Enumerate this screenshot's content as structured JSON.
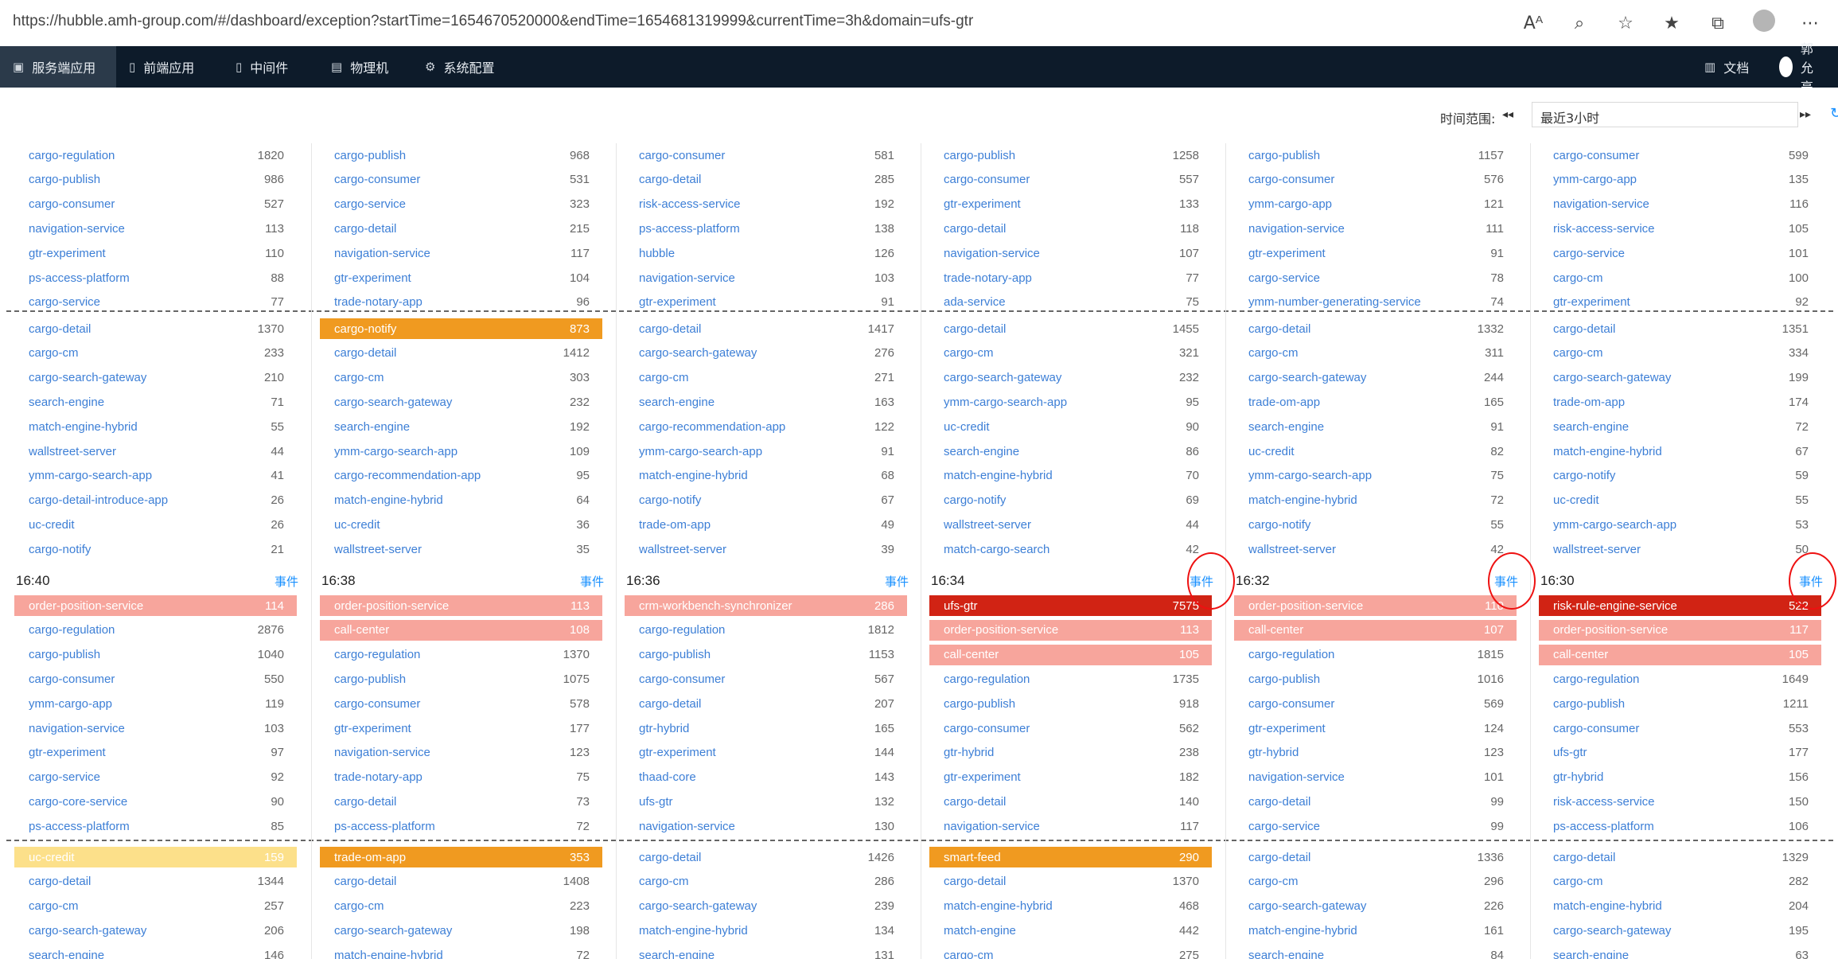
{
  "browser": {
    "url": "https://hubble.amh-group.com/#/dashboard/exception?startTime=1654670520000&endTime=1654681319999&currentTime=3h&domain=ufs-gtr",
    "tool_icons": [
      "Aᴬ",
      "⌕",
      "☆",
      "★",
      "⧉",
      "●",
      "⋯"
    ]
  },
  "nav": {
    "items": [
      {
        "label": "服务端应用",
        "icon": "▣"
      },
      {
        "label": "前端应用",
        "icon": "▯"
      },
      {
        "label": "中间件",
        "icon": "▯"
      },
      {
        "label": "物理机",
        "icon": "▤"
      },
      {
        "label": "系统配置",
        "icon": "⚙"
      }
    ],
    "docs_label": "文档",
    "docs_icon": "▥",
    "user_name": "郭允亮"
  },
  "toolbar": {
    "time_range_label": "时间范围:",
    "prev_icon": "◂◂",
    "time_range_value": "最近3小时",
    "next_icon": "▸▸",
    "refresh_icon": "↻"
  },
  "event_label": "事件",
  "columns": [
    {
      "top1": [
        [
          "cargo-regulation",
          "1820"
        ],
        [
          "cargo-publish",
          "986"
        ],
        [
          "cargo-consumer",
          "527"
        ],
        [
          "navigation-service",
          "113"
        ],
        [
          "gtr-experiment",
          "110"
        ],
        [
          "ps-access-platform",
          "88"
        ],
        [
          "cargo-service",
          "77"
        ]
      ],
      "top2": [
        [
          "cargo-detail",
          "1370"
        ],
        [
          "cargo-cm",
          "233"
        ],
        [
          "cargo-search-gateway",
          "210"
        ],
        [
          "search-engine",
          "71"
        ],
        [
          "match-engine-hybrid",
          "55"
        ],
        [
          "wallstreet-server",
          "44"
        ],
        [
          "ymm-cargo-search-app",
          "41"
        ],
        [
          "cargo-detail-introduce-app",
          "26"
        ],
        [
          "uc-credit",
          "26"
        ],
        [
          "cargo-notify",
          "21"
        ]
      ],
      "time": "16:40",
      "bottom1": [
        [
          "order-position-service",
          "114"
        ],
        [
          "cargo-regulation",
          "2876"
        ],
        [
          "cargo-publish",
          "1040"
        ],
        [
          "cargo-consumer",
          "550"
        ],
        [
          "ymm-cargo-app",
          "119"
        ],
        [
          "navigation-service",
          "103"
        ],
        [
          "gtr-experiment",
          "97"
        ],
        [
          "cargo-service",
          "92"
        ],
        [
          "cargo-core-service",
          "90"
        ],
        [
          "ps-access-platform",
          "85"
        ]
      ],
      "bottom2": [
        [
          "uc-credit",
          "159"
        ],
        [
          "cargo-detail",
          "1344"
        ],
        [
          "cargo-cm",
          "257"
        ],
        [
          "cargo-search-gateway",
          "206"
        ],
        [
          "search-engine",
          "146"
        ]
      ]
    },
    {
      "top1": [
        [
          "cargo-publish",
          "968"
        ],
        [
          "cargo-consumer",
          "531"
        ],
        [
          "cargo-service",
          "323"
        ],
        [
          "cargo-detail",
          "215"
        ],
        [
          "navigation-service",
          "117"
        ],
        [
          "gtr-experiment",
          "104"
        ],
        [
          "trade-notary-app",
          "96"
        ]
      ],
      "top2": [
        [
          "cargo-notify",
          "873"
        ],
        [
          "cargo-detail",
          "1412"
        ],
        [
          "cargo-cm",
          "303"
        ],
        [
          "cargo-search-gateway",
          "232"
        ],
        [
          "search-engine",
          "192"
        ],
        [
          "ymm-cargo-search-app",
          "109"
        ],
        [
          "cargo-recommendation-app",
          "95"
        ],
        [
          "match-engine-hybrid",
          "64"
        ],
        [
          "uc-credit",
          "36"
        ],
        [
          "wallstreet-server",
          "35"
        ]
      ],
      "time": "16:38",
      "bottom1": [
        [
          "order-position-service",
          "113"
        ],
        [
          "call-center",
          "108"
        ],
        [
          "cargo-regulation",
          "1370"
        ],
        [
          "cargo-publish",
          "1075"
        ],
        [
          "cargo-consumer",
          "578"
        ],
        [
          "gtr-experiment",
          "177"
        ],
        [
          "navigation-service",
          "123"
        ],
        [
          "trade-notary-app",
          "75"
        ],
        [
          "cargo-detail",
          "73"
        ],
        [
          "ps-access-platform",
          "72"
        ]
      ],
      "bottom2": [
        [
          "trade-om-app",
          "353"
        ],
        [
          "cargo-detail",
          "1408"
        ],
        [
          "cargo-cm",
          "223"
        ],
        [
          "cargo-search-gateway",
          "198"
        ],
        [
          "match-engine-hybrid",
          "72"
        ]
      ]
    },
    {
      "top1": [
        [
          "cargo-consumer",
          "581"
        ],
        [
          "cargo-detail",
          "285"
        ],
        [
          "risk-access-service",
          "192"
        ],
        [
          "ps-access-platform",
          "138"
        ],
        [
          "hubble",
          "126"
        ],
        [
          "navigation-service",
          "103"
        ],
        [
          "gtr-experiment",
          "91"
        ]
      ],
      "top2": [
        [
          "cargo-detail",
          "1417"
        ],
        [
          "cargo-search-gateway",
          "276"
        ],
        [
          "cargo-cm",
          "271"
        ],
        [
          "search-engine",
          "163"
        ],
        [
          "cargo-recommendation-app",
          "122"
        ],
        [
          "ymm-cargo-search-app",
          "91"
        ],
        [
          "match-engine-hybrid",
          "68"
        ],
        [
          "cargo-notify",
          "67"
        ],
        [
          "trade-om-app",
          "49"
        ],
        [
          "wallstreet-server",
          "39"
        ]
      ],
      "time": "16:36",
      "bottom1": [
        [
          "crm-workbench-synchronizer",
          "286"
        ],
        [
          "cargo-regulation",
          "1812"
        ],
        [
          "cargo-publish",
          "1153"
        ],
        [
          "cargo-consumer",
          "567"
        ],
        [
          "cargo-detail",
          "207"
        ],
        [
          "gtr-hybrid",
          "165"
        ],
        [
          "gtr-experiment",
          "144"
        ],
        [
          "thaad-core",
          "143"
        ],
        [
          "ufs-gtr",
          "132"
        ],
        [
          "navigation-service",
          "130"
        ]
      ],
      "bottom2": [
        [
          "cargo-detail",
          "1426"
        ],
        [
          "cargo-cm",
          "286"
        ],
        [
          "cargo-search-gateway",
          "239"
        ],
        [
          "match-engine-hybrid",
          "134"
        ],
        [
          "search-engine",
          "131"
        ]
      ]
    },
    {
      "top1": [
        [
          "cargo-publish",
          "1258"
        ],
        [
          "cargo-consumer",
          "557"
        ],
        [
          "gtr-experiment",
          "133"
        ],
        [
          "cargo-detail",
          "118"
        ],
        [
          "navigation-service",
          "107"
        ],
        [
          "trade-notary-app",
          "77"
        ],
        [
          "ada-service",
          "75"
        ]
      ],
      "top2": [
        [
          "cargo-detail",
          "1455"
        ],
        [
          "cargo-cm",
          "321"
        ],
        [
          "cargo-search-gateway",
          "232"
        ],
        [
          "ymm-cargo-search-app",
          "95"
        ],
        [
          "uc-credit",
          "90"
        ],
        [
          "search-engine",
          "86"
        ],
        [
          "match-engine-hybrid",
          "70"
        ],
        [
          "cargo-notify",
          "69"
        ],
        [
          "wallstreet-server",
          "44"
        ],
        [
          "match-cargo-search",
          "42"
        ]
      ],
      "time": "16:34",
      "bottom1": [
        [
          "ufs-gtr",
          "7575"
        ],
        [
          "order-position-service",
          "113"
        ],
        [
          "call-center",
          "105"
        ],
        [
          "cargo-regulation",
          "1735"
        ],
        [
          "cargo-publish",
          "918"
        ],
        [
          "cargo-consumer",
          "562"
        ],
        [
          "gtr-hybrid",
          "238"
        ],
        [
          "gtr-experiment",
          "182"
        ],
        [
          "cargo-detail",
          "140"
        ],
        [
          "navigation-service",
          "117"
        ]
      ],
      "bottom2": [
        [
          "smart-feed",
          "290"
        ],
        [
          "cargo-detail",
          "1370"
        ],
        [
          "match-engine-hybrid",
          "468"
        ],
        [
          "match-engine",
          "442"
        ],
        [
          "cargo-cm",
          "275"
        ]
      ]
    },
    {
      "top1": [
        [
          "cargo-publish",
          "1157"
        ],
        [
          "cargo-consumer",
          "576"
        ],
        [
          "ymm-cargo-app",
          "121"
        ],
        [
          "navigation-service",
          "111"
        ],
        [
          "gtr-experiment",
          "91"
        ],
        [
          "cargo-service",
          "78"
        ],
        [
          "ymm-number-generating-service",
          "74"
        ]
      ],
      "top2": [
        [
          "cargo-detail",
          "1332"
        ],
        [
          "cargo-cm",
          "311"
        ],
        [
          "cargo-search-gateway",
          "244"
        ],
        [
          "trade-om-app",
          "165"
        ],
        [
          "search-engine",
          "91"
        ],
        [
          "uc-credit",
          "82"
        ],
        [
          "ymm-cargo-search-app",
          "75"
        ],
        [
          "match-engine-hybrid",
          "72"
        ],
        [
          "cargo-notify",
          "55"
        ],
        [
          "wallstreet-server",
          "42"
        ]
      ],
      "time": "16:32",
      "bottom1": [
        [
          "order-position-service",
          "110"
        ],
        [
          "call-center",
          "107"
        ],
        [
          "cargo-regulation",
          "1815"
        ],
        [
          "cargo-publish",
          "1016"
        ],
        [
          "cargo-consumer",
          "569"
        ],
        [
          "gtr-experiment",
          "124"
        ],
        [
          "gtr-hybrid",
          "123"
        ],
        [
          "navigation-service",
          "101"
        ],
        [
          "cargo-detail",
          "99"
        ],
        [
          "cargo-service",
          "99"
        ]
      ],
      "bottom2": [
        [
          "cargo-detail",
          "1336"
        ],
        [
          "cargo-cm",
          "296"
        ],
        [
          "cargo-search-gateway",
          "226"
        ],
        [
          "match-engine-hybrid",
          "161"
        ],
        [
          "search-engine",
          "84"
        ]
      ]
    },
    {
      "top1": [
        [
          "cargo-consumer",
          "599"
        ],
        [
          "ymm-cargo-app",
          "135"
        ],
        [
          "navigation-service",
          "116"
        ],
        [
          "risk-access-service",
          "105"
        ],
        [
          "cargo-service",
          "101"
        ],
        [
          "cargo-cm",
          "100"
        ],
        [
          "gtr-experiment",
          "92"
        ]
      ],
      "top2": [
        [
          "cargo-detail",
          "1351"
        ],
        [
          "cargo-cm",
          "334"
        ],
        [
          "cargo-search-gateway",
          "199"
        ],
        [
          "trade-om-app",
          "174"
        ],
        [
          "search-engine",
          "72"
        ],
        [
          "match-engine-hybrid",
          "67"
        ],
        [
          "cargo-notify",
          "59"
        ],
        [
          "uc-credit",
          "55"
        ],
        [
          "ymm-cargo-search-app",
          "53"
        ],
        [
          "wallstreet-server",
          "50"
        ]
      ],
      "time": "16:30",
      "bottom1": [
        [
          "risk-rule-engine-service",
          "522"
        ],
        [
          "order-position-service",
          "117"
        ],
        [
          "call-center",
          "105"
        ],
        [
          "cargo-regulation",
          "1649"
        ],
        [
          "cargo-publish",
          "1211"
        ],
        [
          "cargo-consumer",
          "553"
        ],
        [
          "ufs-gtr",
          "177"
        ],
        [
          "gtr-hybrid",
          "156"
        ],
        [
          "risk-access-service",
          "150"
        ],
        [
          "ps-access-platform",
          "106"
        ]
      ],
      "bottom2": [
        [
          "cargo-detail",
          "1329"
        ],
        [
          "cargo-cm",
          "282"
        ],
        [
          "match-engine-hybrid",
          "204"
        ],
        [
          "cargo-search-gateway",
          "195"
        ],
        [
          "search-engine",
          "63"
        ]
      ]
    }
  ],
  "highlights": {
    "colors": {
      "red": "#d12314",
      "pink": "#f7a59c",
      "orange": "#f09a20",
      "yellow": "#fce08a"
    },
    "top2_first": [
      "",
      "orange",
      "",
      "",
      "",
      ""
    ],
    "bottom1": [
      [
        "pink"
      ],
      [
        "pink",
        "pink"
      ],
      [
        "pink"
      ],
      [
        "red",
        "pink",
        "pink"
      ],
      [
        "pink",
        "pink"
      ],
      [
        "red",
        "pink",
        "pink"
      ]
    ],
    "bottom2_first": [
      "yellow",
      "orange",
      "",
      "orange",
      "",
      ""
    ]
  }
}
